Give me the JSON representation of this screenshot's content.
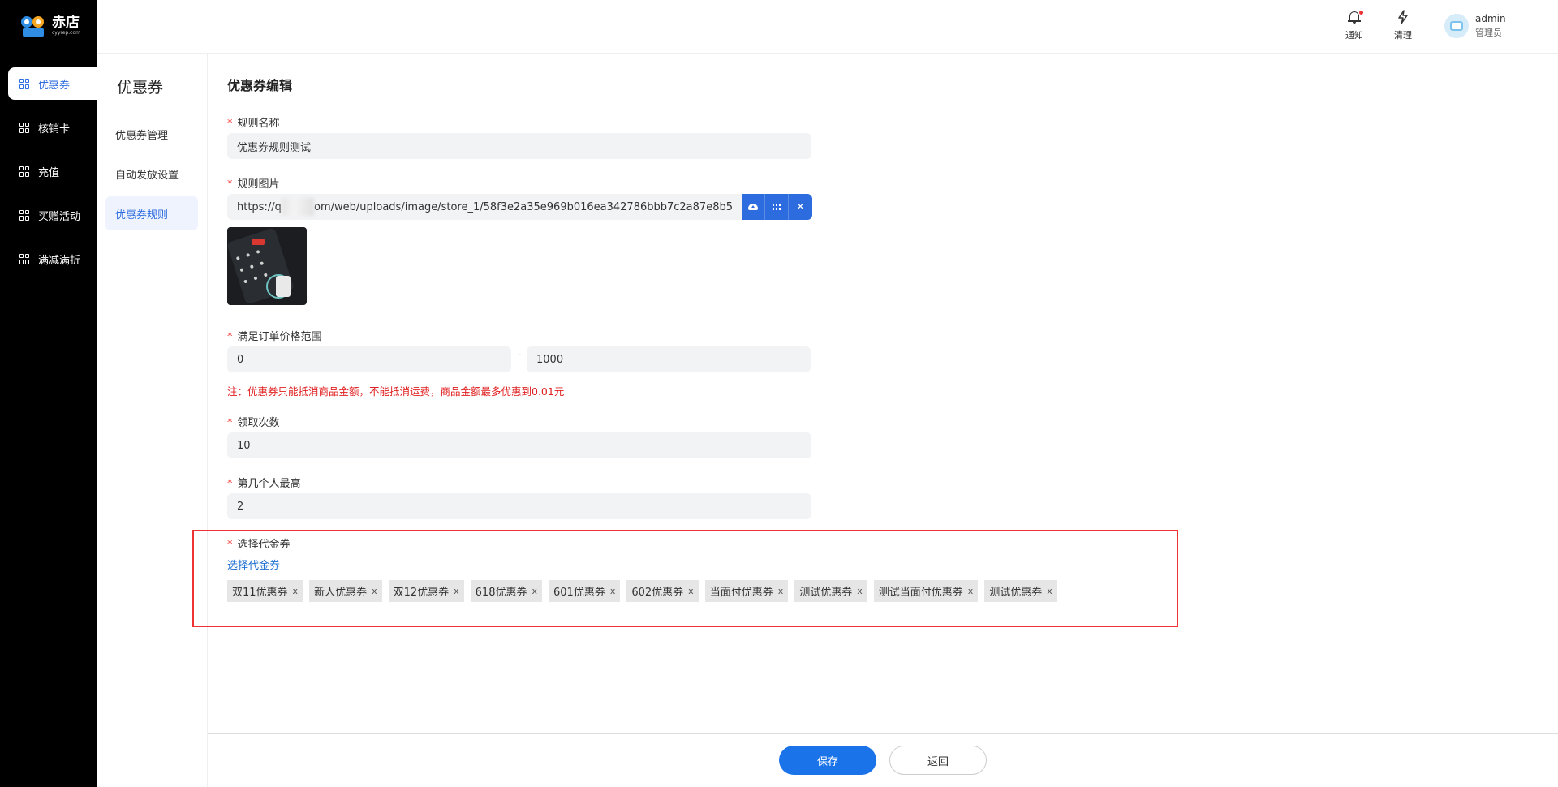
{
  "brand": {
    "name": "赤店",
    "subtitle": "cyyrep.com"
  },
  "sidebar": {
    "items": [
      {
        "label": "优惠券",
        "active": true
      },
      {
        "label": "核销卡",
        "active": false
      },
      {
        "label": "充值",
        "active": false
      },
      {
        "label": "买赠活动",
        "active": false
      },
      {
        "label": "满减满折",
        "active": false
      }
    ]
  },
  "header": {
    "notify_label": "通知",
    "clear_label": "清理",
    "user_name": "admin",
    "user_role": "管理员"
  },
  "submenu": {
    "title": "优惠券",
    "items": [
      {
        "label": "优惠券管理",
        "active": false
      },
      {
        "label": "自动发放设置",
        "active": false
      },
      {
        "label": "优惠券规则",
        "active": true
      }
    ]
  },
  "form": {
    "title": "优惠券编辑",
    "rule_name_label": "规则名称",
    "rule_name_value": "优惠券规则测试",
    "rule_image_label": "规则图片",
    "rule_image_url_prefix": "https://q",
    "rule_image_url_suffix": "om/web/uploads/image/store_1/58f3e2a35e969b016ea342786bbb7c2a87e8b5",
    "price_range_label": "满足订单价格范围",
    "price_min": "0",
    "price_separator": "-",
    "price_max": "1000",
    "note": "注：优惠券只能抵消商品金额，不能抵消运费，商品金额最多优惠到0.01元",
    "receive_count_label": "领取次数",
    "receive_count_value": "10",
    "nth_person_label": "第几个人最高",
    "nth_person_value": "2",
    "voucher_label": "选择代金券",
    "voucher_link": "选择代金券",
    "tags": [
      "双11优惠券",
      "新人优惠券",
      "双12优惠券",
      "618优惠券",
      "601优惠券",
      "602优惠券",
      "当面付优惠券",
      "测试优惠券",
      "测试当面付优惠券",
      "测试优惠券"
    ],
    "tag_remove": "x",
    "required_mark": "*"
  },
  "footer": {
    "save_label": "保存",
    "back_label": "返回"
  },
  "colors": {
    "primary": "#2d6cdf",
    "danger": "#e02020",
    "sidebar_bg": "#000000"
  }
}
